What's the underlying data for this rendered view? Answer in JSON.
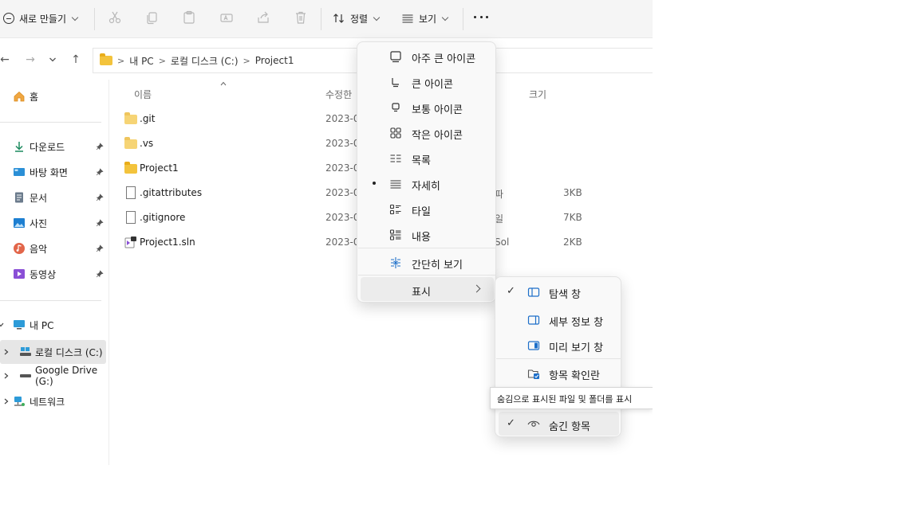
{
  "commandbar": {
    "new_label": "새로 만들기",
    "sort_label": "정렬",
    "view_label": "보기",
    "more_label": "더 보기"
  },
  "address": {
    "crumbs": [
      "내 PC",
      "로컬 디스크 (C:)",
      "Project1"
    ]
  },
  "sidebar": {
    "home": "홈",
    "quick": [
      "다운로드",
      "바탕 화면",
      "문서",
      "사진",
      "음악",
      "동영상"
    ],
    "pc": "내 PC",
    "drives": [
      "로컬 디스크 (C:)",
      "Google Drive (G:)"
    ],
    "network": "네트워크"
  },
  "columns": {
    "name": "이름",
    "modified": "수정한",
    "size": "크기"
  },
  "files": [
    {
      "name": ".git",
      "date": "2023-0",
      "type": "",
      "size": ""
    },
    {
      "name": ".vs",
      "date": "2023-0",
      "type": "",
      "size": ""
    },
    {
      "name": "Project1",
      "date": "2023-0",
      "type": "",
      "size": ""
    },
    {
      "name": ".gitattributes",
      "date": "2023-0",
      "type": "파",
      "size": "3KB"
    },
    {
      "name": ".gitignore",
      "date": "2023-0",
      "type": "일",
      "size": "7KB"
    },
    {
      "name": "Project1.sln",
      "date": "2023-0",
      "type": "Sol",
      "size": "2KB"
    }
  ],
  "view_menu": {
    "items": [
      "아주 큰 아이콘",
      "큰 아이콘",
      "보통 아이콘",
      "작은 아이콘",
      "목록",
      "자세히",
      "타일",
      "내용"
    ],
    "compact": "간단히 보기",
    "show": "표시",
    "selected": "자세히"
  },
  "show_menu": {
    "nav_pane": "탐색 창",
    "details_pane": "세부 정보 창",
    "preview_pane": "미리 보기 창",
    "checkboxes": "항목 확인란",
    "hidden_items": "숨긴 항목",
    "tooltip": "숨김으로 표시된 파일 및 폴더를 표시"
  }
}
